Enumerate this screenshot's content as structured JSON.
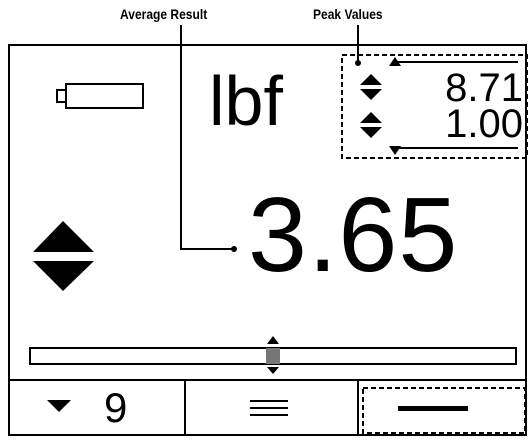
{
  "callouts": {
    "average_result": "Average Result",
    "peak_values": "Peak Values"
  },
  "display": {
    "unit": "lbf",
    "peak_max": "8.71",
    "peak_min": "1.00",
    "average_result": "3.65",
    "load_bar_level": 0.5
  },
  "softkeys": {
    "left_value": "9"
  },
  "icons": {
    "battery": "battery-icon",
    "peak_max_arrows": "up-down-arrows-icon",
    "peak_min_arrows": "up-down-arrows-icon",
    "direction": "up-down-arrows-icon",
    "softkey_left": "down-triangle-icon",
    "softkey_center": "menu-lines-icon",
    "softkey_right": "horizontal-bar-icon"
  }
}
